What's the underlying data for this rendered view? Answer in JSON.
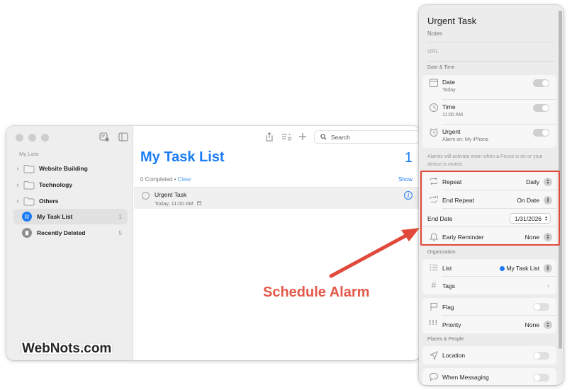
{
  "sidebar": {
    "heading": "My Lists",
    "groups": [
      {
        "label": "Website Building"
      },
      {
        "label": "Technology"
      },
      {
        "label": "Others"
      }
    ],
    "lists": [
      {
        "label": "My Task List",
        "count": "1"
      },
      {
        "label": "Recently Deleted",
        "count": "5"
      }
    ]
  },
  "main": {
    "search_placeholder": "Search",
    "list_title": "My Task List",
    "list_count": "1",
    "completed_text": "0 Completed • ",
    "clear_label": "Clear",
    "show_label": "Show",
    "task": {
      "title": "Urgent Task",
      "subtitle": "Today, 11:00 AM"
    }
  },
  "watermark": "WebNots.com",
  "annotation": "Schedule Alarm",
  "detail": {
    "title": "Urgent Task",
    "notes_placeholder": "Notes",
    "url_placeholder": "URL",
    "date_time_heading": "Date & Time",
    "date": {
      "label": "Date",
      "sub": "Today"
    },
    "time": {
      "label": "Time",
      "sub": "11:00 AM"
    },
    "urgent": {
      "label": "Urgent",
      "sub": "Alarm on: My iPhone"
    },
    "alarm_note": "Alarms will activate even when a Focus is on or your device is muted.",
    "repeat": {
      "label": "Repeat",
      "value": "Daily"
    },
    "end_repeat": {
      "label": "End Repeat",
      "value": "On Date"
    },
    "end_date": {
      "label": "End Date",
      "value": "1/31/2026"
    },
    "early_reminder": {
      "label": "Early Reminder",
      "value": "None"
    },
    "organization_heading": "Organization",
    "list": {
      "label": "List",
      "value": "My Task List"
    },
    "tags": {
      "label": "Tags"
    },
    "flag": {
      "label": "Flag"
    },
    "priority": {
      "label": "Priority",
      "value": "None"
    },
    "places_heading": "Places & People",
    "location": {
      "label": "Location"
    },
    "messaging": {
      "label": "When Messaging"
    }
  },
  "colors": {
    "accent": "#1b7cf5",
    "annotation": "#e0493b"
  }
}
